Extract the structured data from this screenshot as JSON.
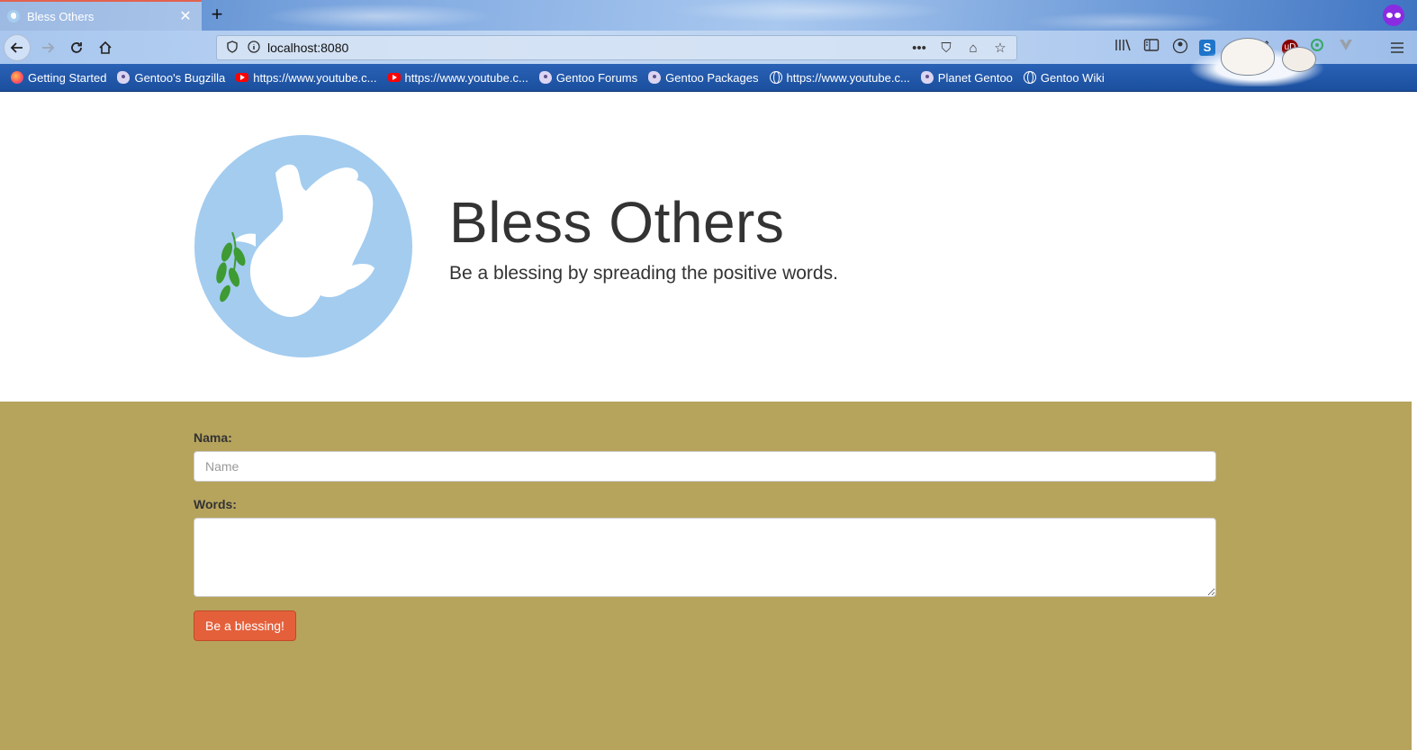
{
  "browser": {
    "tab": {
      "title": "Bless Others",
      "close": "✕"
    },
    "new_tab": "+",
    "url": "localhost:8080",
    "url_actions": [
      "•••",
      "⛉",
      "⌂",
      "☆"
    ],
    "bookmarks": [
      {
        "label": "Getting Started",
        "icon": "firefox"
      },
      {
        "label": "Gentoo's Bugzilla",
        "icon": "gentoo"
      },
      {
        "label": "https://www.youtube.c...",
        "icon": "youtube"
      },
      {
        "label": "https://www.youtube.c...",
        "icon": "youtube"
      },
      {
        "label": "Gentoo Forums",
        "icon": "gentoo"
      },
      {
        "label": "Gentoo Packages",
        "icon": "gentoo"
      },
      {
        "label": "https://www.youtube.c...",
        "icon": "globe"
      },
      {
        "label": "Planet Gentoo",
        "icon": "gentoo"
      },
      {
        "label": "Gentoo Wiki",
        "icon": "globe"
      }
    ]
  },
  "hero": {
    "title": "Bless Others",
    "subtitle": "Be a blessing by spreading the positive words."
  },
  "form": {
    "name_label": "Nama:",
    "name_placeholder": "Name",
    "words_label": "Words:",
    "submit_label": "Be a blessing!"
  },
  "colors": {
    "form_background": "#b6a45d",
    "button": "#e4603b",
    "logo_circle": "#a3ccef",
    "leaf": "#3e9a32"
  }
}
